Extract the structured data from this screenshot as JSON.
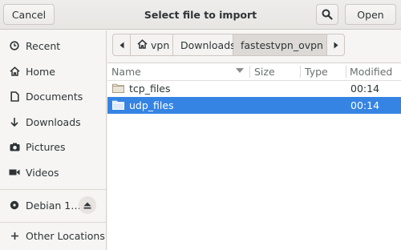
{
  "header": {
    "cancel_label": "Cancel",
    "title": "Select file to import",
    "search_icon": "search-icon",
    "open_label": "Open"
  },
  "sidebar": {
    "items": [
      {
        "icon": "clock-icon",
        "label": "Recent"
      },
      {
        "icon": "home-icon",
        "label": "Home"
      },
      {
        "icon": "document-icon",
        "label": "Documents"
      },
      {
        "icon": "download-icon",
        "label": "Downloads"
      },
      {
        "icon": "camera-icon",
        "label": "Pictures"
      },
      {
        "icon": "video-icon",
        "label": "Videos"
      }
    ],
    "devices": [
      {
        "icon": "disk-icon",
        "label": "Debian 1…",
        "eject_icon": "eject-icon"
      }
    ],
    "other": {
      "icon": "plus-icon",
      "label": "Other Locations"
    }
  },
  "pathbar": {
    "crumbs": [
      "vpn",
      "Downloads",
      "fastestvpn_ovpn"
    ],
    "active_index": 2
  },
  "file_list": {
    "columns": [
      "Name",
      "Size",
      "Type",
      "Modified"
    ],
    "sort_column": "Name",
    "rows": [
      {
        "name": "tcp_files",
        "size": "",
        "type": "",
        "modified": "00:14",
        "selected": false
      },
      {
        "name": "udp_files",
        "size": "",
        "type": "",
        "modified": "00:14",
        "selected": true
      }
    ]
  },
  "colors": {
    "selection": "#3584e4",
    "folder": "#c8b89a",
    "header_bg": "#e8e6e3"
  }
}
